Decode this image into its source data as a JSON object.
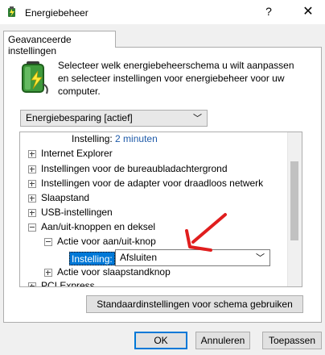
{
  "window": {
    "title": "Energiebeheer",
    "help_glyph": "?",
    "close_glyph": "✕"
  },
  "tab": {
    "label": "Geavanceerde instellingen"
  },
  "intro": "Selecteer welk energiebeheerschema u wilt aanpassen en selecteer instellingen voor energiebeheer voor uw computer.",
  "scheme_select": {
    "value": "Energiebesparing [actief]"
  },
  "tree": {
    "top_setting": {
      "label": "Instelling:",
      "value": "2 minuten"
    },
    "items": [
      {
        "label": "Internet Explorer",
        "state": "collapsed"
      },
      {
        "label": "Instellingen voor de bureaubladachtergrond",
        "state": "collapsed"
      },
      {
        "label": "Instellingen voor de adapter voor draadloos netwerk",
        "state": "collapsed"
      },
      {
        "label": "Slaapstand",
        "state": "collapsed"
      },
      {
        "label": "USB-instellingen",
        "state": "collapsed"
      },
      {
        "label": "Aan/uit-knoppen en deksel",
        "state": "expanded"
      }
    ],
    "sub_expanded": {
      "label": "Actie voor aan/uit-knop",
      "state": "expanded"
    },
    "selected_setting": {
      "label": "Instelling:",
      "value": "Afsluiten"
    },
    "sub_collapsed": {
      "label": "Actie voor slaapstandknop",
      "state": "collapsed"
    },
    "partial_item": {
      "label": "PCI Express"
    }
  },
  "buttons": {
    "defaults": "Standaardinstellingen voor schema gebruiken",
    "ok": "OK",
    "cancel": "Annuleren",
    "apply": "Toepassen"
  },
  "colors": {
    "accent": "#0078d7",
    "link": "#1e5aa8",
    "annotation_arrow": "#e01e1e"
  }
}
